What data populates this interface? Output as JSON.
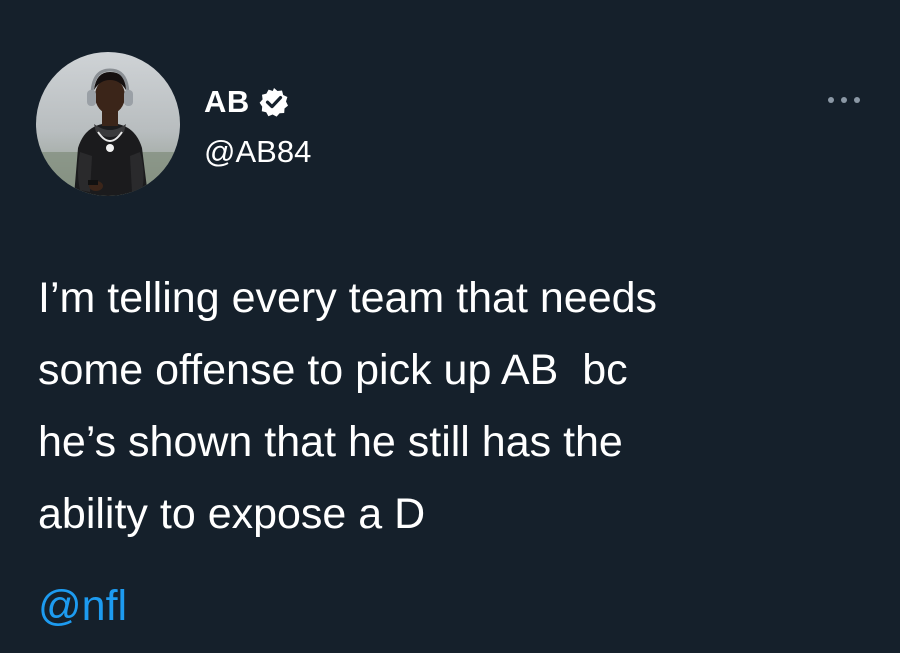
{
  "author": {
    "display_name": "AB",
    "handle": "@AB84",
    "verified": true
  },
  "tweet": {
    "line_1": "I’m telling every team that needs",
    "line_2": "some offense to pick up AB  bc",
    "line_3": "he’s shown that he still has the",
    "line_4": "ability to expose a D",
    "mention": "@nfl"
  },
  "icons": {
    "verified": "verified-badge-icon",
    "more": "more-options-icon"
  },
  "colors": {
    "background": "#15202b",
    "text": "#ffffff",
    "link": "#1d9bf0",
    "muted": "#8b98a5"
  }
}
